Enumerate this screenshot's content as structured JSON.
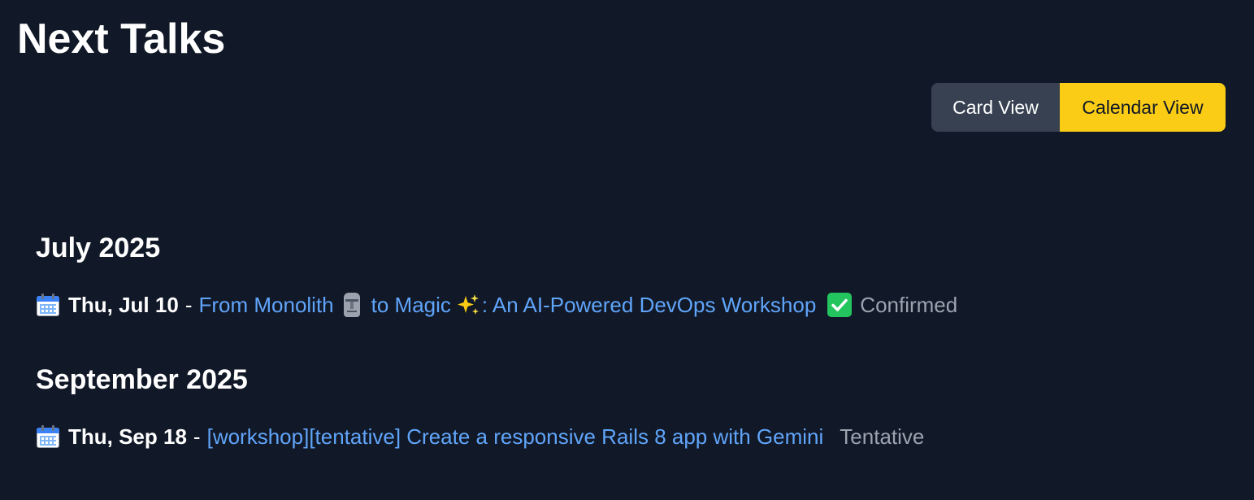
{
  "page": {
    "title": "Next Talks"
  },
  "view_toggle": {
    "card_label": "Card View",
    "calendar_label": "Calendar View",
    "active": "Calendar View"
  },
  "months": [
    {
      "heading": "July 2025",
      "events": [
        {
          "date": "Thu, Jul 10",
          "separator": "-",
          "title_part1": "From Monolith",
          "title_part2": "to Magic",
          "title_part3": ": An AI-Powered DevOps Workshop",
          "status": "Confirmed",
          "status_icon": "check-mark-icon"
        }
      ]
    },
    {
      "heading": "September 2025",
      "events": [
        {
          "date": "Thu, Sep 18",
          "separator": "-",
          "title": "[workshop][tentative] Create a responsive Rails 8 app with Gemini",
          "status": "Tentative"
        }
      ]
    }
  ],
  "colors": {
    "background": "#111827",
    "link": "#60a5fa",
    "status": "#9ca3af",
    "toggle_inactive": "#374151",
    "toggle_active": "#facc15",
    "confirmed": "#22c55e"
  }
}
